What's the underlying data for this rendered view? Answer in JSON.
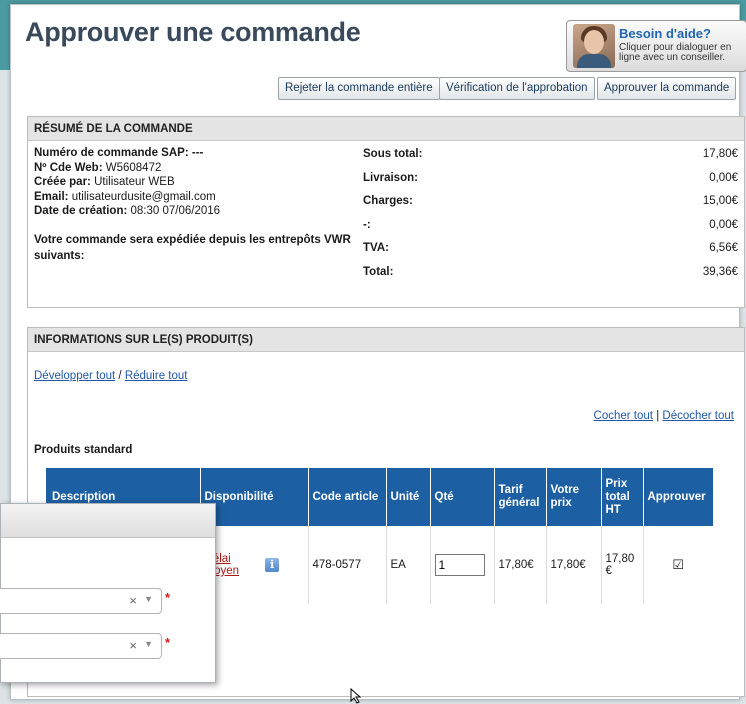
{
  "header": {
    "title": "Approuver une commande",
    "help_title": "Besoin d'aide?",
    "help_sub": "Cliquer pour dialoguer en ligne avec un conseiller."
  },
  "actions": {
    "reject_label": "Rejeter la commande entière",
    "verify_label": "Vérification de l'approbation",
    "approve_label": "Approuver la commande"
  },
  "summary": {
    "heading": "RÉSUMÉ DE LA COMMANDE",
    "sap_label": "Numéro de commande SAP:",
    "sap_value": "---",
    "web_label": "Nº Cde Web:",
    "web_value": "W5608472",
    "created_by_label": "Créée par:",
    "created_by_value": "Utilisateur WEB",
    "email_label": "Email:",
    "email_value": "utilisateurdusite@gmail.com",
    "date_label": "Date de création:",
    "date_value": "08:30 07/06/2016",
    "shipping_note": "Votre commande sera expédiée depuis les entrepôts VWR suivants:",
    "totals": [
      {
        "label": "Sous total:",
        "value": "17,80€"
      },
      {
        "label": "Livraison:",
        "value": "0,00€"
      },
      {
        "label": "Charges:",
        "value": "15,00€"
      },
      {
        "label": "-:",
        "value": "0,00€"
      },
      {
        "label": "TVA:",
        "value": "6,56€"
      },
      {
        "label": "Total:",
        "value": "39,36€"
      }
    ]
  },
  "products": {
    "heading": "INFORMATIONS SUR LE(S) PRODUIT(S)",
    "expand_all": "Développer tout",
    "separator1": "/",
    "collapse_all": "Réduire tout",
    "check_all": "Cocher tout",
    "separator2": "|",
    "uncheck_all": "Décocher tout",
    "standard_label": "Produits standard",
    "columns": {
      "description": "Description",
      "availability": "Disponibilité",
      "code": "Code article",
      "unit": "Unité",
      "qty": "Qté",
      "list_price_1": "Tarif",
      "list_price_2": "général",
      "your_price_1": "Votre",
      "your_price_2": "prix",
      "total_1": "Prix",
      "total_2": "total",
      "total_3": "HT",
      "approve": "Approuver"
    },
    "row": {
      "availability_1": "Délai",
      "availability_2": "moyen",
      "code": "478-0577",
      "unit": "EA",
      "qty": "1",
      "list_price": "17,80€",
      "your_price": "17,80€",
      "total_1": "17,80",
      "total_2": "€",
      "approve_mark": "☑"
    }
  },
  "popup": {
    "clear_mark": "×",
    "arrow_mark": "▼",
    "required_mark": "*"
  },
  "colors": {
    "accent": "#1d5fa3",
    "teal_band": "#4a9aa1",
    "title": "#3a4a5c",
    "link": "#2258a8",
    "availability_link": "#b01818"
  }
}
